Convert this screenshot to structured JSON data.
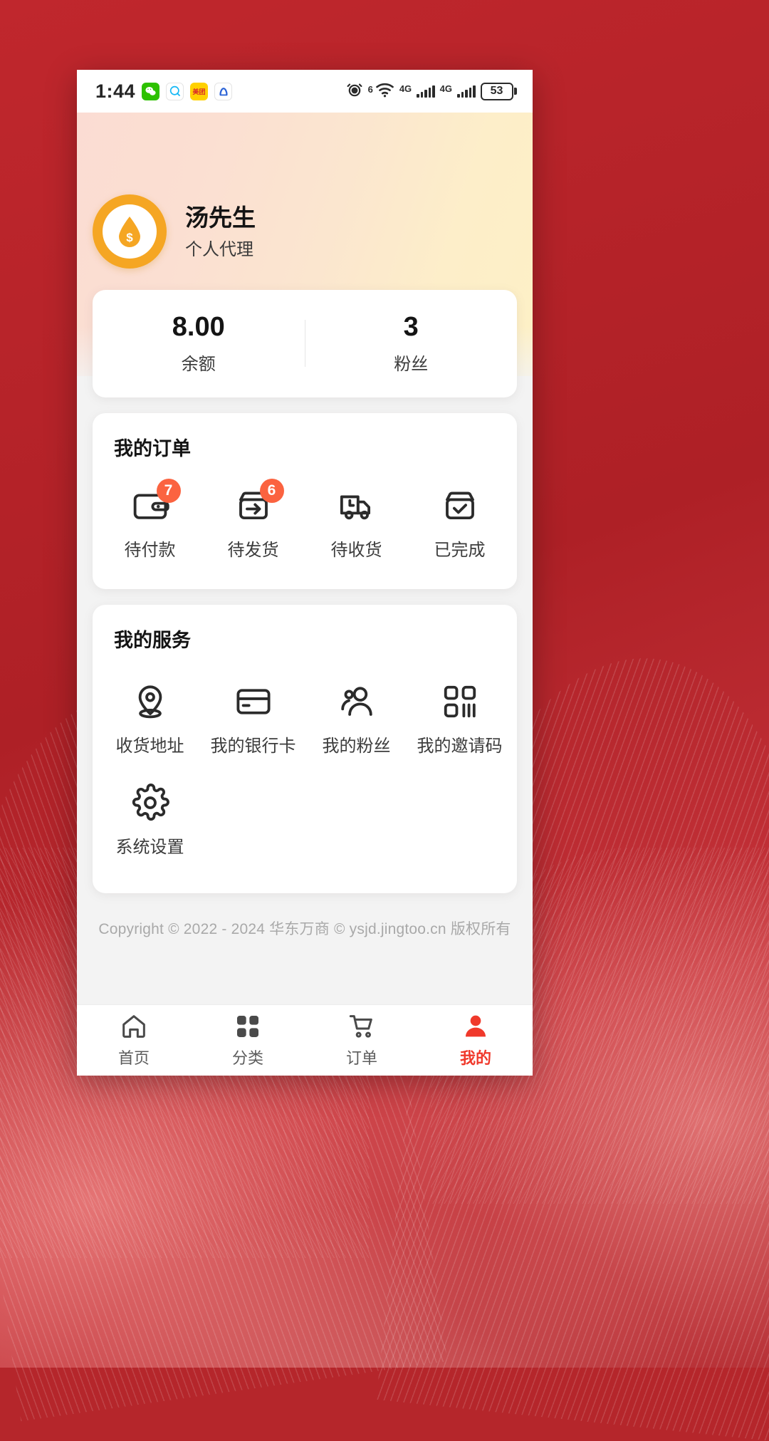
{
  "status_bar": {
    "time": "1:44",
    "apps": [
      "wechat-icon",
      "qq-icon",
      "meituan-icon",
      "browser-icon"
    ],
    "app_labels": {
      "wechat": "微",
      "qq": "Q",
      "meituan": "美团",
      "browser": "Θ"
    },
    "alarm_icon": "alarm-icon",
    "wifi_superscript": "6",
    "wifi_icon": "wifi-icon",
    "network_label_1": "4G",
    "network_label_2": "4G",
    "battery_percent": "53"
  },
  "profile": {
    "avatar_icon": "coin-water-drop-avatar",
    "name": "汤先生",
    "role": "个人代理"
  },
  "stats": [
    {
      "value": "8.00",
      "label": "余额"
    },
    {
      "value": "3",
      "label": "粉丝"
    }
  ],
  "orders": {
    "title": "我的订单",
    "items": [
      {
        "label": "待付款",
        "icon": "wallet-icon",
        "badge": "7"
      },
      {
        "label": "待发货",
        "icon": "box-arrow-icon",
        "badge": "6"
      },
      {
        "label": "待收货",
        "icon": "truck-clock-icon",
        "badge": ""
      },
      {
        "label": "已完成",
        "icon": "box-check-icon",
        "badge": ""
      }
    ]
  },
  "services": {
    "title": "我的服务",
    "items": [
      {
        "label": "收货地址",
        "icon": "location-pin-icon"
      },
      {
        "label": "我的银行卡",
        "icon": "bank-card-icon"
      },
      {
        "label": "我的粉丝",
        "icon": "people-icon"
      },
      {
        "label": "我的邀请码",
        "icon": "qrcode-icon"
      },
      {
        "label": "系统设置",
        "icon": "gear-icon"
      }
    ]
  },
  "footer": {
    "copyright": "Copyright © 2022 - 2024 华东万商 © ysjd.jingtoo.cn 版权所有"
  },
  "tabbar": {
    "items": [
      {
        "label": "首页",
        "icon": "home-icon",
        "active": false
      },
      {
        "label": "分类",
        "icon": "grid-icon",
        "active": false
      },
      {
        "label": "订单",
        "icon": "cart-icon",
        "active": false
      },
      {
        "label": "我的",
        "icon": "user-icon",
        "active": true
      }
    ]
  },
  "colors": {
    "brand_red": "#f0392b",
    "badge_orange": "#fb6340",
    "avatar_gold": "#f5a623",
    "wallpaper_red": "#b5262b"
  }
}
